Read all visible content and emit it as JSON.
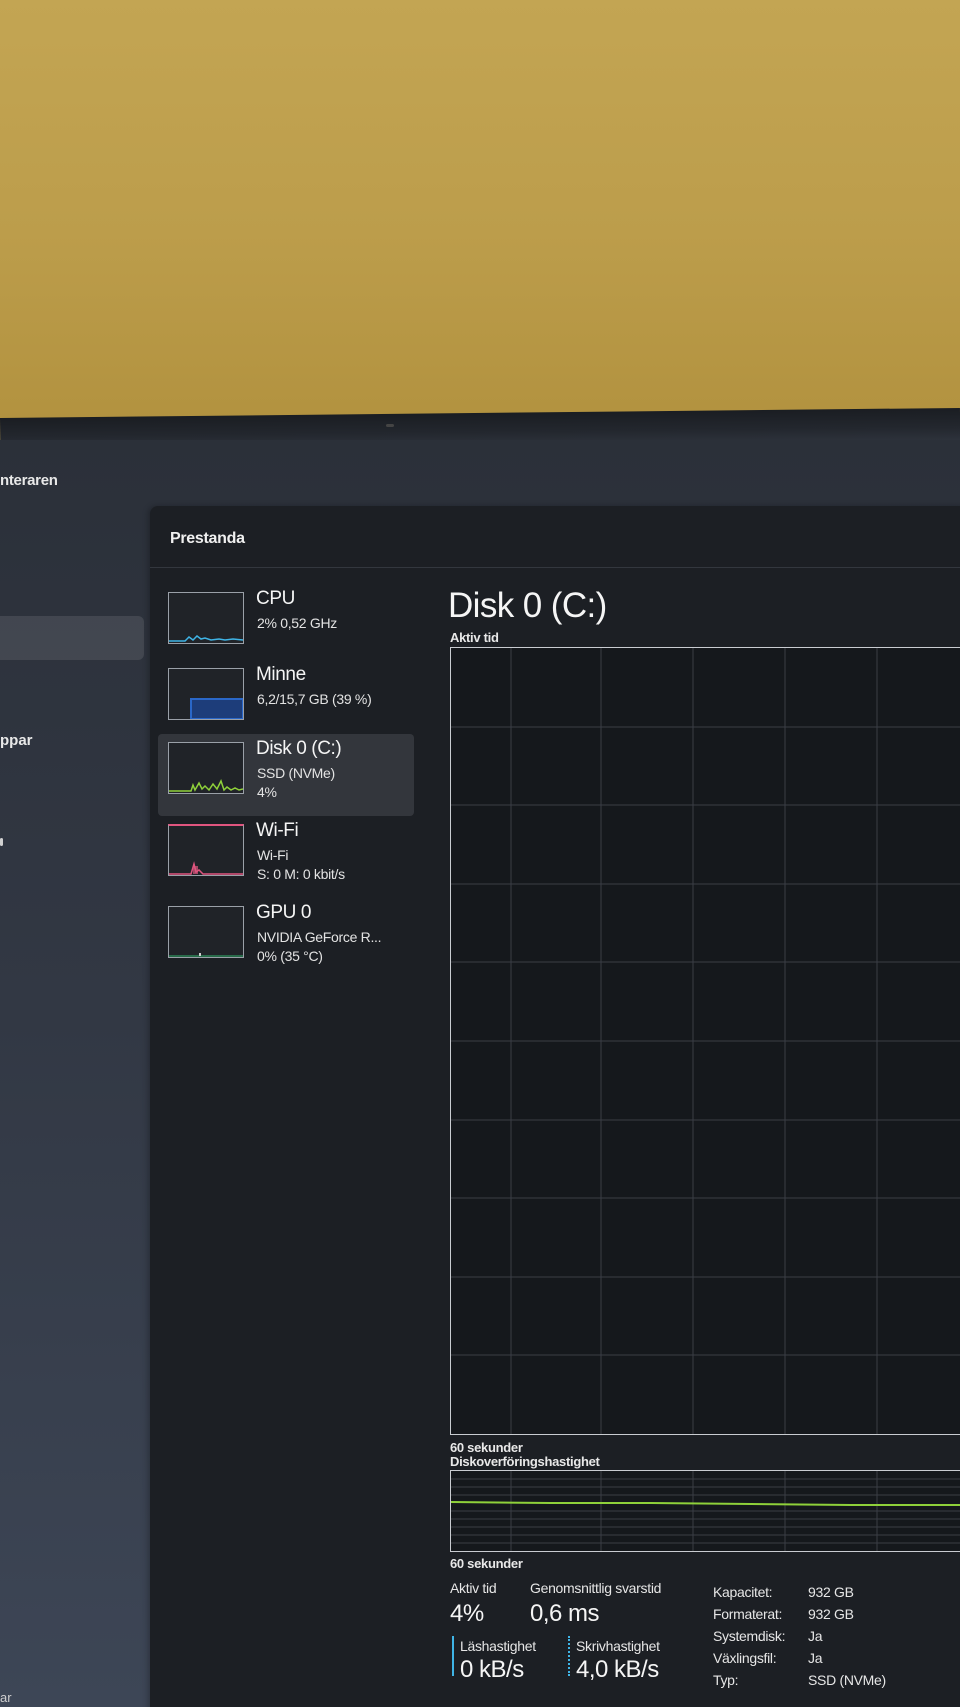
{
  "app": {
    "title_partial": "nteraren"
  },
  "nav": {
    "partial_item": "ppar",
    "bottom_partial": "ar"
  },
  "panel": {
    "title": "Prestanda"
  },
  "devices": [
    {
      "name": "CPU",
      "line1": "2% 0,52 GHz",
      "line2": "",
      "graph_color": "#3fb4e6",
      "icon": "cpu-graph-icon"
    },
    {
      "name": "Minne",
      "line1": "6,2/15,7 GB (39 %)",
      "line2": "",
      "graph_color": "#2a67c8",
      "icon": "memory-graph-icon",
      "usage_fraction": 0.39
    },
    {
      "name": "Disk 0 (C:)",
      "line1": "SSD (NVMe)",
      "line2": "4%",
      "graph_color": "#8fd13a",
      "icon": "disk-graph-icon",
      "selected": true
    },
    {
      "name": "Wi-Fi",
      "line1": "Wi-Fi",
      "line2": "S: 0 M: 0 kbit/s",
      "graph_color": "#e0557f",
      "icon": "wifi-graph-icon"
    },
    {
      "name": "GPU 0",
      "line1": "NVIDIA GeForce R...",
      "line2": "0% (35 °C)",
      "graph_color": "#2fb36b",
      "icon": "gpu-graph-icon"
    }
  ],
  "detail": {
    "title": "Disk 0 (C:)",
    "active_time_chart_label": "Aktiv tid",
    "time_label_1": "60 sekunder",
    "transfer_chart_label": "Diskoverföringshastighet",
    "time_label_2": "60 sekunder",
    "stats": {
      "active_time_label": "Aktiv tid",
      "active_time_value": "4%",
      "response_label": "Genomsnittlig svarstid",
      "response_value": "0,6 ms",
      "read_label": "Läshastighet",
      "read_value": "0 kB/s",
      "write_label": "Skrivhastighet",
      "write_value": "4,0 kB/s"
    },
    "properties": [
      {
        "key": "Kapacitet:",
        "value": "932 GB"
      },
      {
        "key": "Formaterat:",
        "value": "932 GB"
      },
      {
        "key": "Systemdisk:",
        "value": "Ja"
      },
      {
        "key": "Växlingsfil:",
        "value": "Ja"
      },
      {
        "key": "Typ:",
        "value": "SSD (NVMe)"
      }
    ],
    "colors": {
      "accent_green": "#8fd13a",
      "read_bar": "#3fb4e6"
    }
  }
}
